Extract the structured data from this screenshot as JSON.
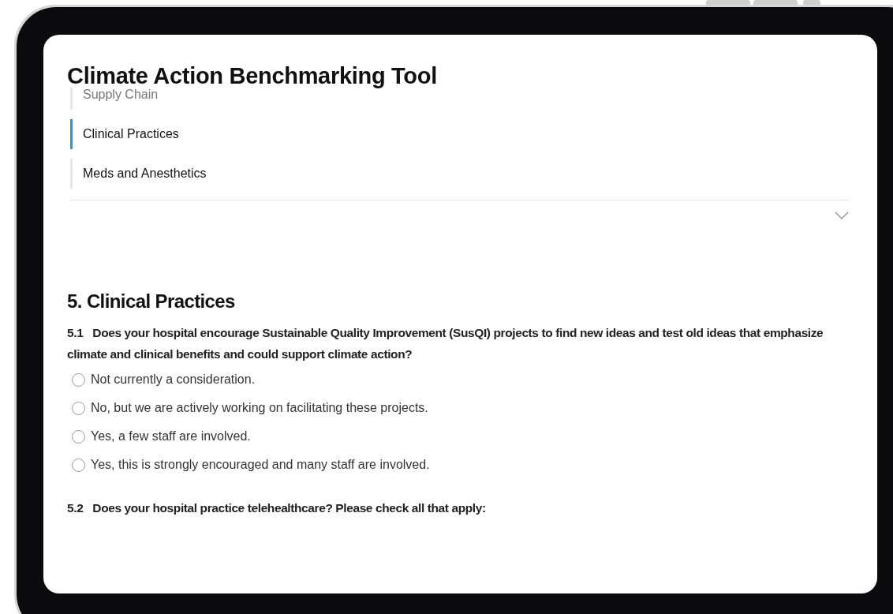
{
  "title": "Climate Action Benchmarking Tool",
  "nav": {
    "items": [
      {
        "label": "Supply Chain",
        "selected": false
      },
      {
        "label": "Clinical Practices",
        "selected": true
      },
      {
        "label": "Meds and Anesthetics",
        "selected": false
      }
    ]
  },
  "section": {
    "title": "5. Clinical Practices",
    "questions": [
      {
        "number": "5.1",
        "text": "Does your hospital encourage Sustainable Quality Improvement (SusQI) projects to find new ideas and test old ideas that emphasize climate and clinical benefits and could support climate action?",
        "options": [
          {
            "label": "Not currently a consideration.",
            "selected": false
          },
          {
            "label": "No, but we are actively working on facilitating these projects.",
            "selected": false
          },
          {
            "label": "Yes, a few staff are involved.",
            "selected": false
          },
          {
            "label": "Yes, this is strongly encouraged and many staff are involved.",
            "selected": false
          }
        ]
      },
      {
        "number": "5.2",
        "text": "Does your hospital practice telehealthcare? Please check all that apply:"
      }
    ]
  }
}
